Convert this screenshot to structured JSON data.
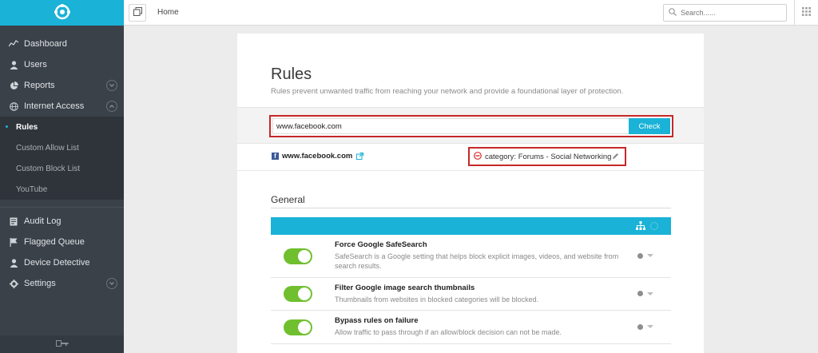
{
  "sidebar": {
    "logo_icon": "shield-logo-icon",
    "items": [
      {
        "label": "Dashboard",
        "icon": "activity-icon"
      },
      {
        "label": "Users",
        "icon": "user-icon"
      },
      {
        "label": "Reports",
        "icon": "pie-chart-icon",
        "chevron": "down"
      },
      {
        "label": "Internet Access",
        "icon": "globe-icon",
        "chevron": "up"
      }
    ],
    "sub_items": [
      {
        "label": "Rules",
        "active": true
      },
      {
        "label": "Custom Allow List"
      },
      {
        "label": "Custom Block List"
      },
      {
        "label": "YouTube"
      }
    ],
    "lower_items": [
      {
        "label": "Audit Log",
        "icon": "log-icon"
      },
      {
        "label": "Flagged Queue",
        "icon": "flag-icon"
      },
      {
        "label": "Device Detective",
        "icon": "user-icon"
      },
      {
        "label": "Settings",
        "icon": "gear-icon",
        "chevron": "down"
      }
    ],
    "footer_icon": "key-icon"
  },
  "topbar": {
    "breadcrumb": "Home",
    "search_placeholder": "Search......"
  },
  "page": {
    "title": "Rules",
    "subtitle": "Rules prevent unwanted traffic from reaching your network and provide a foundational layer of protection.",
    "check_input_value": "www.facebook.com",
    "check_button": "Check",
    "result_domain": "www.facebook.com",
    "result_category": "category: Forums - Social Networking"
  },
  "general": {
    "section_title": "General",
    "rules": [
      {
        "title": "Force Google SafeSearch",
        "description": "SafeSearch is a Google setting that helps block explicit images, videos, and website from search results.",
        "enabled": true
      },
      {
        "title": "Filter Google image search thumbnails",
        "description": "Thumbnails from websites in blocked categories will be blocked.",
        "enabled": true
      },
      {
        "title": "Bypass rules on failure",
        "description": "Allow traffic to pass through if an allow/block decision can not be made.",
        "enabled": true
      }
    ]
  },
  "colors": {
    "accent": "#1ab2d7",
    "sidebar_bg": "#3b4149",
    "toggle_on": "#6fbf2f",
    "highlight_border": "#c62828",
    "facebook": "#3b5998"
  }
}
